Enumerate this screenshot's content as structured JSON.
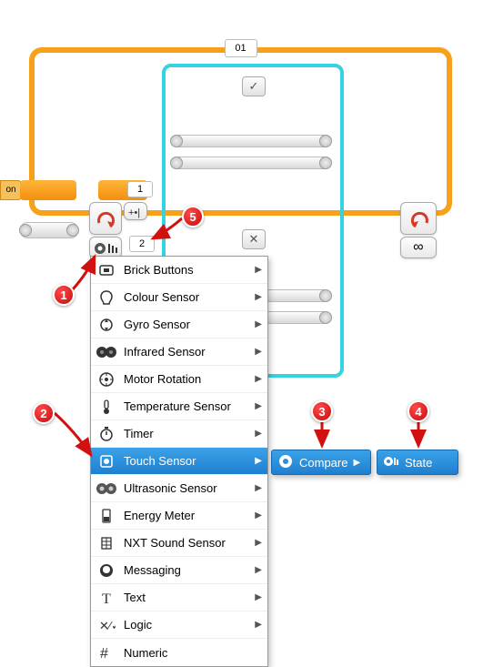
{
  "outer_loop": {
    "tab_label": "01"
  },
  "port1_label": "1",
  "port2_label": "2",
  "left_tab": "on",
  "check_btn": "✓",
  "x_btn": "✕",
  "infinity": "∞",
  "menu": {
    "items": [
      {
        "label": "Brick Buttons",
        "icon": "brick",
        "has_sub": true
      },
      {
        "label": "Colour Sensor",
        "icon": "colour",
        "has_sub": true
      },
      {
        "label": "Gyro Sensor",
        "icon": "gyro",
        "has_sub": true
      },
      {
        "label": "Infrared Sensor",
        "icon": "ir",
        "has_sub": true
      },
      {
        "label": "Motor Rotation",
        "icon": "motor",
        "has_sub": true
      },
      {
        "label": "Temperature Sensor",
        "icon": "temp",
        "has_sub": true
      },
      {
        "label": "Timer",
        "icon": "timer",
        "has_sub": true
      },
      {
        "label": "Touch Sensor",
        "icon": "touch",
        "has_sub": true,
        "selected": true
      },
      {
        "label": "Ultrasonic Sensor",
        "icon": "ultra",
        "has_sub": true
      },
      {
        "label": "Energy Meter",
        "icon": "energy",
        "has_sub": true
      },
      {
        "label": "NXT Sound Sensor",
        "icon": "sound",
        "has_sub": true
      },
      {
        "label": "Messaging",
        "icon": "msg",
        "has_sub": true
      },
      {
        "label": "Text",
        "icon": "text",
        "has_sub": true
      },
      {
        "label": "Logic",
        "icon": "logic",
        "has_sub": true
      },
      {
        "label": "Numeric",
        "icon": "numeric",
        "has_sub": false
      }
    ]
  },
  "submenu1": {
    "label": "Compare"
  },
  "submenu2": {
    "label": "State"
  },
  "callouts": {
    "c1": "1",
    "c2": "2",
    "c3": "3",
    "c4": "4",
    "c5": "5"
  }
}
